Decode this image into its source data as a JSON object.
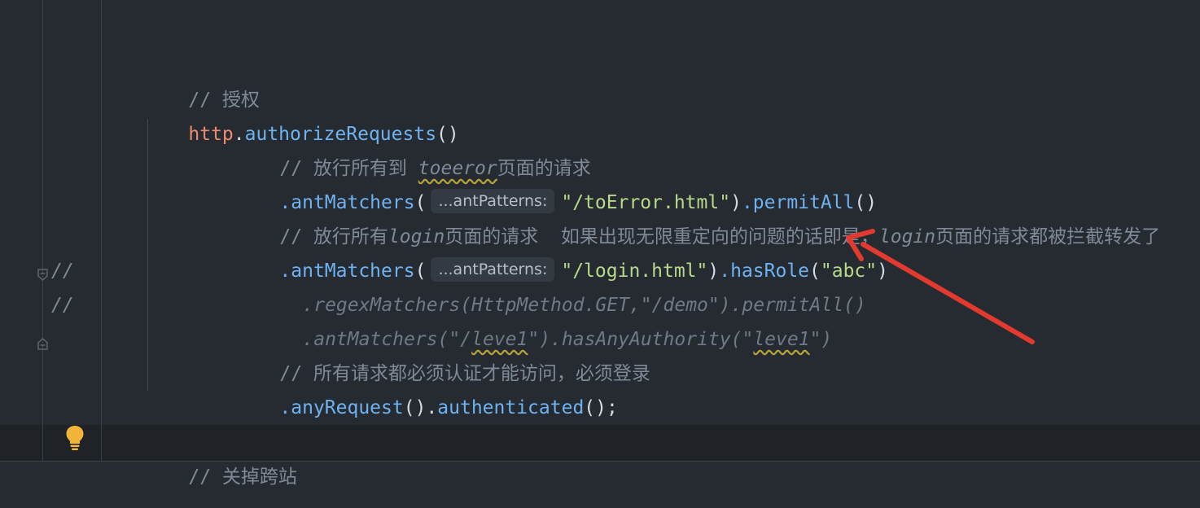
{
  "editor": {
    "lines": {
      "l1_comment": "// 授权",
      "l2_var": "http",
      "l2_dot": ".",
      "l2_method": "authorizeRequests",
      "l2_parens": "()",
      "l3_comment_prefix": "// 放行所有到 ",
      "l3_comment_typo": "toeeror",
      "l3_comment_suffix": "页面的请求",
      "l4_dot": ".",
      "l4_method": "antMatchers",
      "l4_open": "(",
      "l4_hint": "...antPatterns:",
      "l4_string": "\"/toError.html\"",
      "l4_close": ")",
      "l4_dot2": ".",
      "l4_method2": "permitAll",
      "l4_parens2": "()",
      "l5_comment_a": "// 放行所有",
      "l5_comment_b": "login",
      "l5_comment_c": "页面的请求  如果出现无限重定向的问题的话即是，",
      "l5_comment_d": "login",
      "l5_comment_e": "页面的请求都被拦截转发了",
      "l6_dot": ".",
      "l6_method": "antMatchers",
      "l6_open": "(",
      "l6_hint": "...antPatterns:",
      "l6_string": "\"/login.html\"",
      "l6_close": ")",
      "l6_dot2": ".",
      "l6_method2": "hasRole",
      "l6_open2": "(",
      "l6_string2": "\"abc\"",
      "l6_close2": ")",
      "l7_slash": "//",
      "l7_code": ".regexMatchers(HttpMethod.GET,\"/demo\").permitAll()",
      "l8_slash": "//",
      "l8_code_a": ".antMatchers(\"/",
      "l8_code_typo": "leve1",
      "l8_code_b": "\").hasAnyAuthority(\"",
      "l8_code_typo2": "leve1",
      "l8_code_c": "\")",
      "l9_comment": "// 所有请求都必须认证才能访问，必须登录",
      "l10_dot": ".",
      "l10_method": "anyRequest",
      "l10_parens": "().",
      "l10_method2": "authenticated",
      "l10_end": "();",
      "l11_comment": "// 关掉跨站"
    },
    "icons": {
      "fold_open": "fold-open-icon",
      "fold_close": "fold-close-icon",
      "bulb": "lightbulb-icon",
      "arrow": "red-annotation-arrow"
    },
    "colors": {
      "background": "#262b31",
      "comment": "#7f8a96",
      "method": "#6fb2f2",
      "string": "#b7d98a",
      "variable": "#ee8a6f",
      "arrow": "#e23a2e"
    }
  }
}
